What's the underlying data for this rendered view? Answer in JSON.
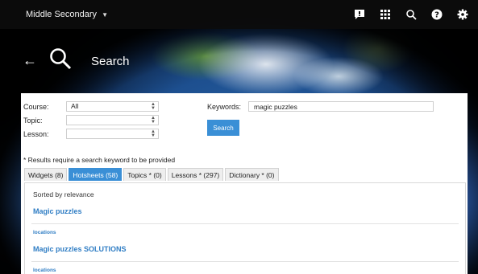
{
  "topbar": {
    "course_switcher": "Middle Secondary",
    "icons": [
      "comment-icon",
      "grid-icon",
      "search-icon",
      "help-icon",
      "settings-icon"
    ]
  },
  "hero": {
    "title": "Search",
    "back_icon": "back-arrow-icon",
    "search_icon": "search-icon"
  },
  "form": {
    "course_label": "Course:",
    "course_value": "All",
    "topic_label": "Topic:",
    "topic_value": "",
    "lesson_label": "Lesson:",
    "lesson_value": "",
    "keywords_label": "Keywords:",
    "keywords_value": "magic puzzles",
    "search_button": "Search",
    "note": "* Results require a search keyword to be provided"
  },
  "tabs": [
    {
      "label": "Widgets (8)",
      "active": false
    },
    {
      "label": "Hotsheets (58)",
      "active": true
    },
    {
      "label": "Topics * (0)",
      "active": false
    },
    {
      "label": "Lessons * (297)",
      "active": false
    },
    {
      "label": "Dictionary * (0)",
      "active": false
    }
  ],
  "results": {
    "sort_label": "Sorted by relevance",
    "items": [
      {
        "title": "Magic puzzles",
        "category": "locations"
      },
      {
        "title": "Magic puzzles SOLUTIONS",
        "category": "locations"
      }
    ]
  },
  "colors": {
    "accent": "#3a8fd6",
    "link": "#2f7dc4",
    "topbar": "#0c0c0c"
  }
}
